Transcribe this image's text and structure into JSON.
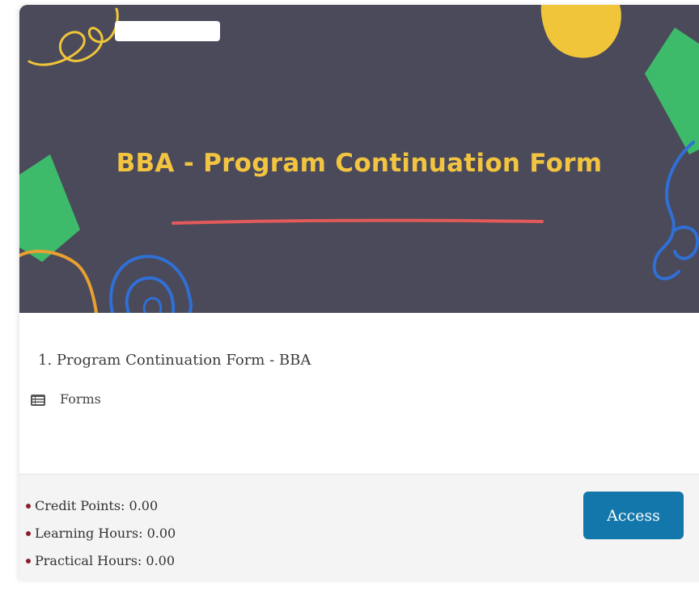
{
  "banner": {
    "title": "BBA - Program Continuation Form",
    "colors": {
      "background": "#4a4a5a",
      "title": "#f2c440",
      "underline": "#e25a5a",
      "yellow_blob": "#f0c53a",
      "green_shape": "#3dbb6a",
      "blue_scribble": "#2f6fd6",
      "orange_scribble": "#e8a030"
    }
  },
  "item": {
    "title": "1. Program Continuation Form - BBA",
    "type_icon": "list-icon",
    "type_label": "Forms"
  },
  "footer": {
    "stats": [
      {
        "label": "Credit Points: 0.00"
      },
      {
        "label": "Learning Hours: 0.00"
      },
      {
        "label": "Practical Hours: 0.00"
      }
    ],
    "access_label": "Access",
    "access_color": "#1477ab"
  }
}
